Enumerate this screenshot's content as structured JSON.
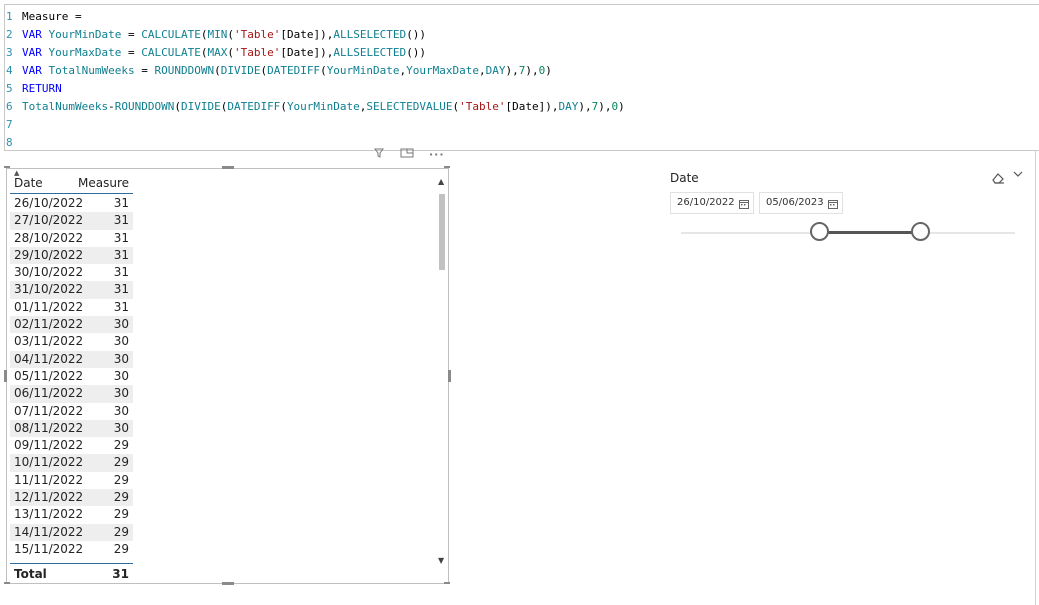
{
  "editor": {
    "lines": [
      {
        "num": "1",
        "text": "Measure ="
      },
      {
        "num": "2",
        "text": "VAR YourMinDate = CALCULATE(MIN('Table'[Date]),ALLSELECTED())"
      },
      {
        "num": "3",
        "text": "VAR YourMaxDate = CALCULATE(MAX('Table'[Date]),ALLSELECTED())"
      },
      {
        "num": "4",
        "text": "VAR TotalNumWeeks = ROUNDDOWN(DIVIDE(DATEDIFF(YourMinDate,YourMaxDate,DAY),7),0)"
      },
      {
        "num": "5",
        "text": "RETURN"
      },
      {
        "num": "6",
        "text": "TotalNumWeeks-ROUNDDOWN(DIVIDE(DATEDIFF(YourMinDate,SELECTEDVALUE('Table'[Date]),DAY),7),0)"
      },
      {
        "num": "7",
        "text": ""
      },
      {
        "num": "8",
        "text": ""
      }
    ]
  },
  "table": {
    "headers": {
      "date": "Date",
      "measure": "Measure"
    },
    "rows": [
      {
        "date": "26/10/2022",
        "measure": "31"
      },
      {
        "date": "27/10/2022",
        "measure": "31"
      },
      {
        "date": "28/10/2022",
        "measure": "31"
      },
      {
        "date": "29/10/2022",
        "measure": "31"
      },
      {
        "date": "30/10/2022",
        "measure": "31"
      },
      {
        "date": "31/10/2022",
        "measure": "31"
      },
      {
        "date": "01/11/2022",
        "measure": "31"
      },
      {
        "date": "02/11/2022",
        "measure": "30"
      },
      {
        "date": "03/11/2022",
        "measure": "30"
      },
      {
        "date": "04/11/2022",
        "measure": "30"
      },
      {
        "date": "05/11/2022",
        "measure": "30"
      },
      {
        "date": "06/11/2022",
        "measure": "30"
      },
      {
        "date": "07/11/2022",
        "measure": "30"
      },
      {
        "date": "08/11/2022",
        "measure": "30"
      },
      {
        "date": "09/11/2022",
        "measure": "29"
      },
      {
        "date": "10/11/2022",
        "measure": "29"
      },
      {
        "date": "11/11/2022",
        "measure": "29"
      },
      {
        "date": "12/11/2022",
        "measure": "29"
      },
      {
        "date": "13/11/2022",
        "measure": "29"
      },
      {
        "date": "14/11/2022",
        "measure": "29"
      },
      {
        "date": "15/11/2022",
        "measure": "29"
      }
    ],
    "total": {
      "label": "Total",
      "value": "31"
    },
    "header_icons": [
      "filter-icon",
      "focus-mode-icon",
      "more-options-icon"
    ]
  },
  "slicer": {
    "title": "Date",
    "start_date": "26/10/2022",
    "end_date": "05/06/2023",
    "icons": [
      "eraser-icon",
      "chevron-down-icon",
      "calendar-icon"
    ]
  },
  "colors": {
    "line_number": "#2b91af",
    "keyword": "#0000ff",
    "variable": "#0f7f8f",
    "string": "#a31515",
    "number": "#098658",
    "table_accent": "#2e6b9e",
    "alt_row": "#eeeeee"
  }
}
